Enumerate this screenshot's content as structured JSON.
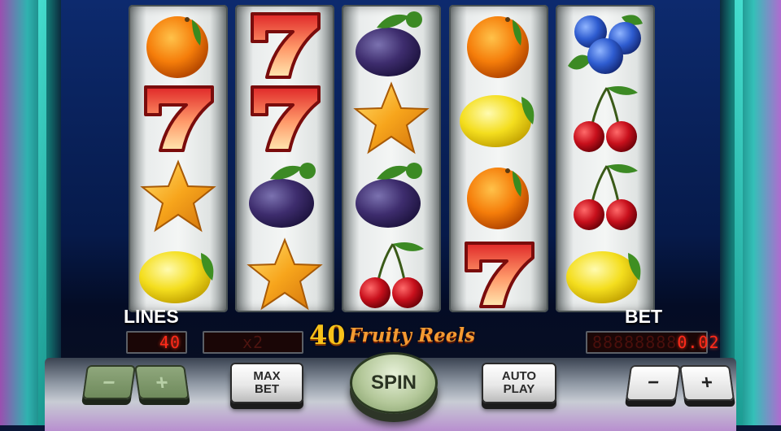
{
  "game": {
    "logo_number": "40",
    "logo_name": "Fruity Reels"
  },
  "reels": [
    {
      "symbols": [
        "orange",
        "seven",
        "star",
        "lemon"
      ]
    },
    {
      "symbols": [
        "seven",
        "seven",
        "plum",
        "star"
      ]
    },
    {
      "symbols": [
        "plum",
        "star",
        "plum",
        "cherry"
      ]
    },
    {
      "symbols": [
        "orange",
        "lemon",
        "orange",
        "seven"
      ]
    },
    {
      "symbols": [
        "blueberry",
        "cherry",
        "cherry",
        "lemon"
      ]
    }
  ],
  "lines": {
    "label": "LINES",
    "value": "40"
  },
  "multiplier": {
    "value": "x2"
  },
  "bet": {
    "label": "BET",
    "dim_digits": "88888888",
    "value": "0.02"
  },
  "buttons": {
    "lines_minus": "−",
    "lines_plus": "+",
    "max_bet_line1": "MAX",
    "max_bet_line2": "BET",
    "spin": "SPIN",
    "auto_play_line1": "AUTO",
    "auto_play_line2": "PLAY",
    "bet_minus": "−",
    "bet_plus": "+"
  },
  "colors": {
    "lcd_text": "#ff2a1a",
    "logo_gold": "#f6c21a",
    "spin_green": "#b4c89a",
    "cabinet_blue": "#0d2a6e",
    "pillar_teal": "#2fb3b0"
  }
}
